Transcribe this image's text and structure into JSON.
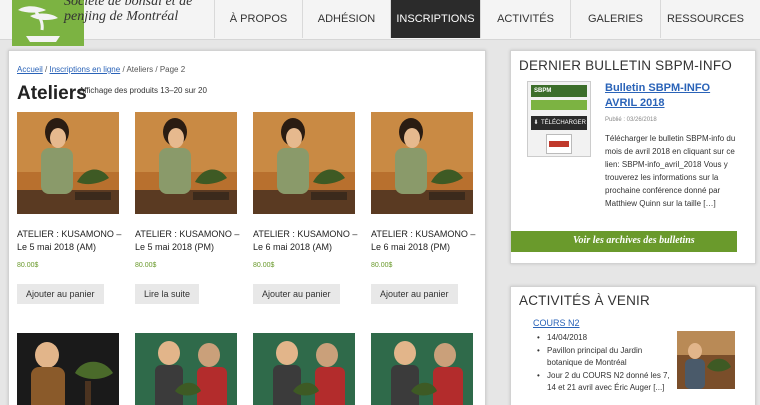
{
  "site": {
    "logo_line1": "Société de bonsaï et de",
    "logo_line2": "penjing de Montréal"
  },
  "nav": {
    "items": [
      {
        "label": "À PROPOS",
        "active": false
      },
      {
        "label": "ADHÉSION",
        "active": false
      },
      {
        "label": "INSCRIPTIONS",
        "active": true
      },
      {
        "label": "ACTIVITÉS",
        "active": false
      },
      {
        "label": "GALERIES",
        "active": false
      },
      {
        "label": "RESSOURCES",
        "active": false
      }
    ]
  },
  "breadcrumb": {
    "home": "Accueil",
    "sep1": "/",
    "online": "Inscriptions en ligne",
    "sep2": "/",
    "current": "Ateliers / Page 2"
  },
  "page": {
    "title": "Ateliers",
    "result_count": "Affichage des produits 13–20 sur 20"
  },
  "products": [
    {
      "name": "ATELIER : KUSAMONO – Le 5 mai 2018 (AM)",
      "price": "80.00$",
      "button": "Ajouter au panier"
    },
    {
      "name": "ATELIER : KUSAMONO – Le 5 mai 2018 (PM)",
      "price": "80.00$",
      "button": "Lire la suite"
    },
    {
      "name": "ATELIER : KUSAMONO – Le 6 mai 2018 (AM)",
      "price": "80.00$",
      "button": "Ajouter au panier"
    },
    {
      "name": "ATELIER : KUSAMONO – Le 6 mai 2018 (PM)",
      "price": "80.00$",
      "button": "Ajouter au panier"
    }
  ],
  "bulletin": {
    "title": "DERNIER BULLETIN SBPM-INFO",
    "link": "Bulletin SBPM-INFO AVRIL 2018",
    "date": "Publié : 03/26/2018",
    "text": "Télécharger le bulletin SBPM-info du mois de avril 2018 en cliquant sur ce lien: SBPM-info_avril_2018 Vous y trouverez les informations sur la prochaine conférence donné par Matthiew Quinn sur la taille […]",
    "thumb_header": "SBPM",
    "download_label": "TÉLÉCHARGER",
    "archive": "Voir les archives des bulletins"
  },
  "events": {
    "title": "ACTIVITÉS À VENIR",
    "course_link": "COURS N2",
    "items": [
      "14/04/2018",
      "Pavillon principal du Jardin botanique de Montréal",
      "Jour 2 du COURS N2 donné les 7, 14 et 21 avril avec Éric Auger [...]"
    ]
  },
  "colors": {
    "brand_green": "#7cb342",
    "accent_green": "#6a9a2c",
    "nav_active": "#2b2b2b",
    "link_blue": "#2a63b8"
  }
}
